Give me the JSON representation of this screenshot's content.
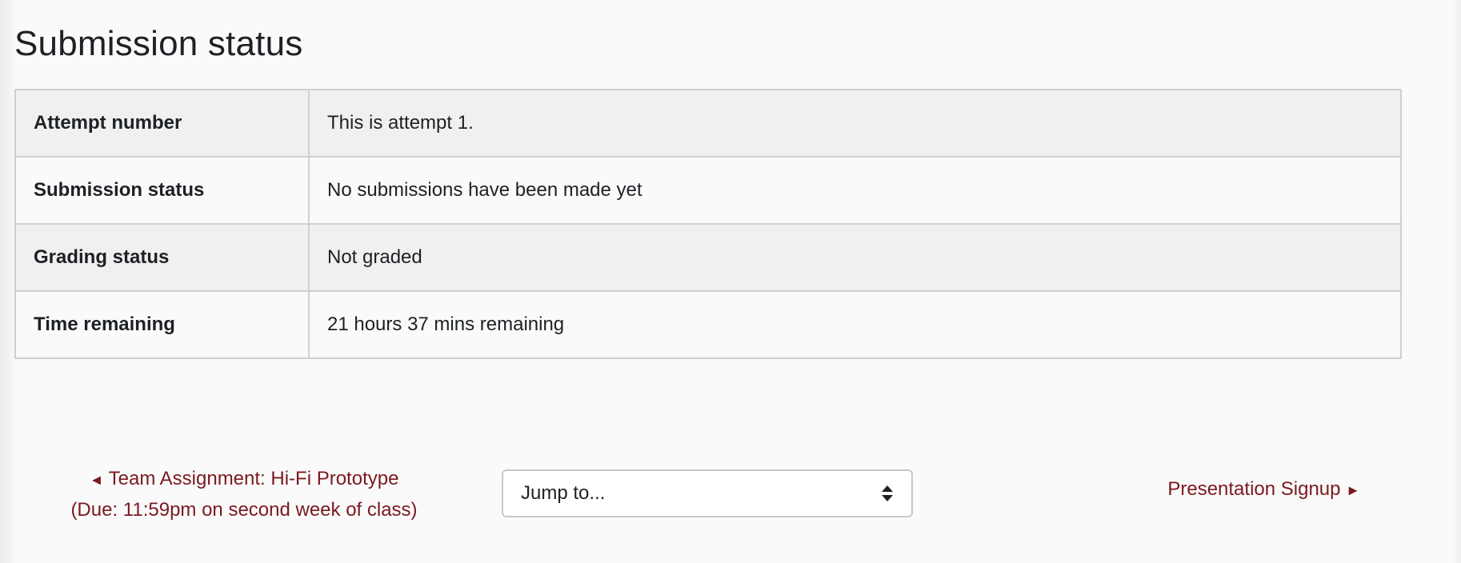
{
  "page": {
    "title": "Submission status"
  },
  "table": {
    "rows": [
      {
        "label": "Attempt number",
        "value": "This is attempt 1."
      },
      {
        "label": "Submission status",
        "value": "No submissions have been made yet"
      },
      {
        "label": "Grading status",
        "value": "Not graded"
      },
      {
        "label": "Time remaining",
        "value": "21 hours 37 mins remaining"
      }
    ]
  },
  "navigation": {
    "prev": {
      "arrow": "◄",
      "title": "Team Assignment: Hi-Fi Prototype",
      "subtitle": "(Due: 11:59pm on second week of class)"
    },
    "jump": {
      "label": "Jump to...",
      "icon": "up-down-arrows-icon"
    },
    "next": {
      "title": "Presentation Signup",
      "arrow": "►"
    }
  },
  "colors": {
    "link": "#7a1a1f",
    "text": "#1d2125",
    "table_border": "#d0d0d0",
    "table_row_alt": "#f0f0f0",
    "background": "#fafafa"
  }
}
